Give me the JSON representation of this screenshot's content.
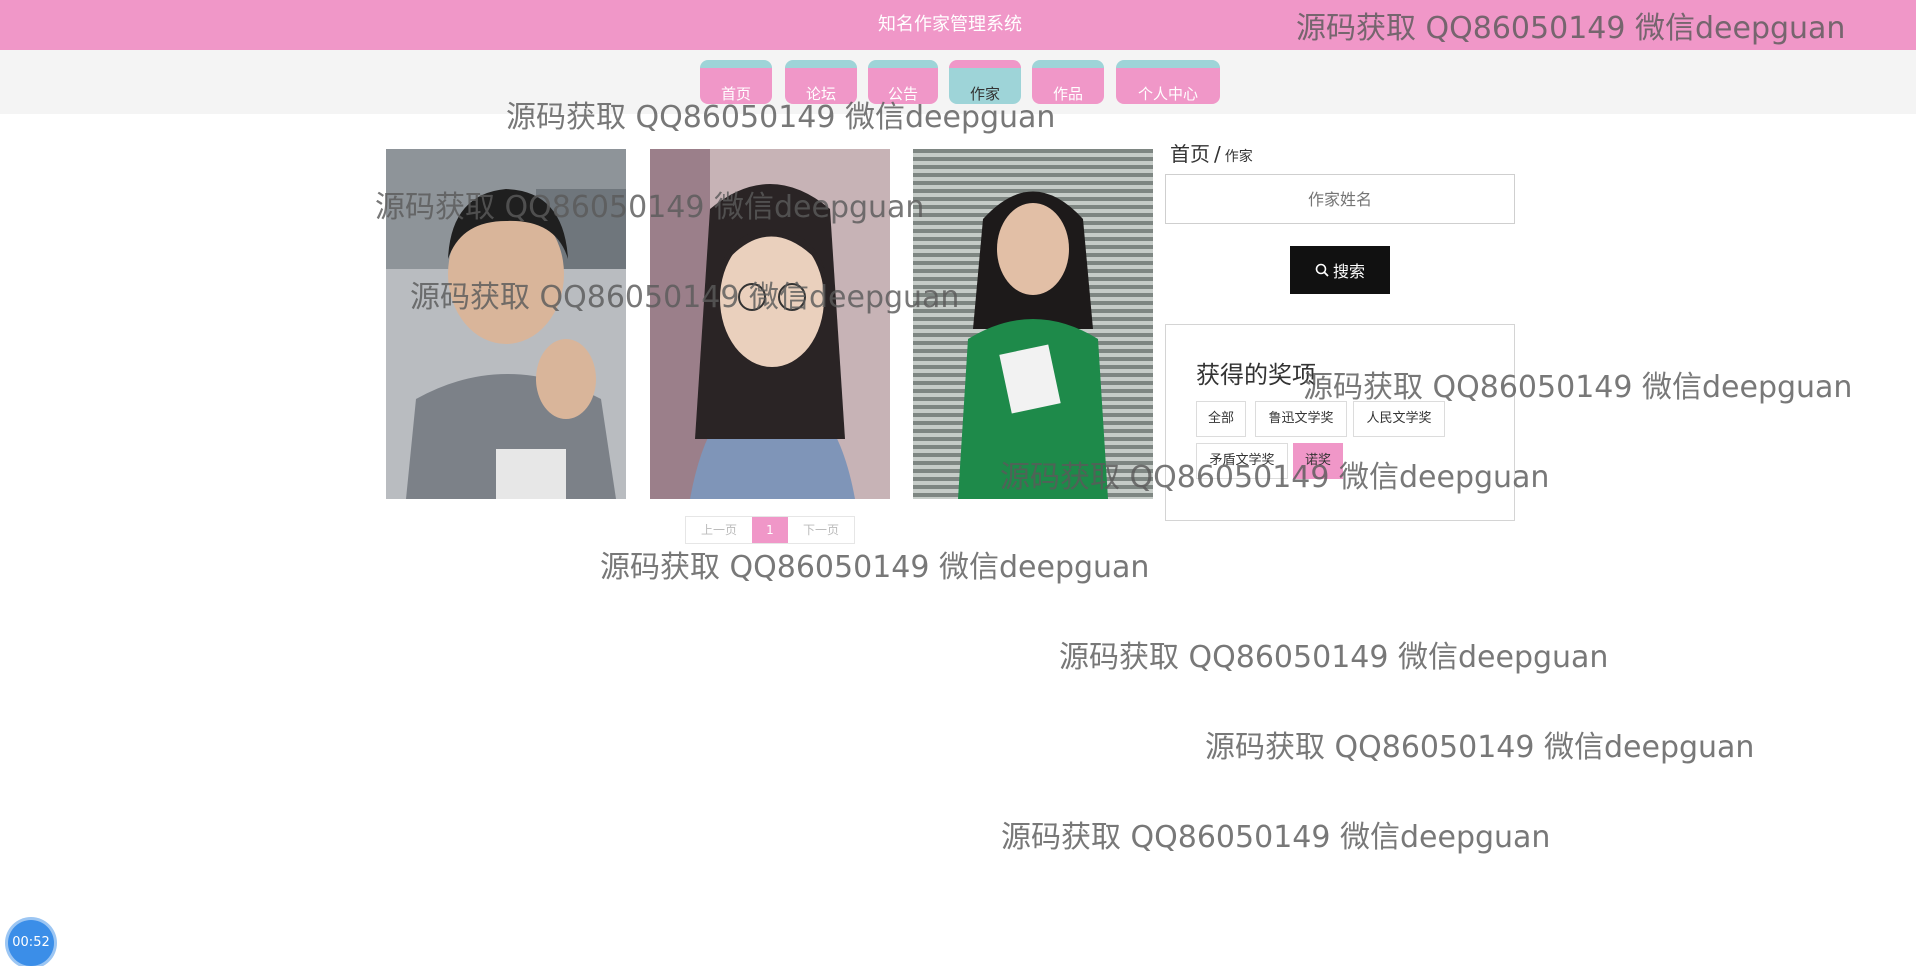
{
  "header": {
    "title": "知名作家管理系统"
  },
  "nav": {
    "items": [
      {
        "label": "首页"
      },
      {
        "label": "论坛"
      },
      {
        "label": "公告"
      },
      {
        "label": "作家"
      },
      {
        "label": "作品"
      },
      {
        "label": "个人中心"
      }
    ],
    "active": "作家"
  },
  "writers": [
    {
      "photo": "writer-photo-man"
    },
    {
      "photo": "writer-photo-woman-glasses"
    },
    {
      "photo": "writer-photo-woman-green"
    }
  ],
  "pagination": {
    "prev": "上一页",
    "current": "1",
    "next": "下一页"
  },
  "breadcrumb": {
    "home": "首页",
    "sep": "/",
    "current": "作家"
  },
  "search": {
    "placeholder": "作家姓名",
    "button": "搜索",
    "icon": "search-icon"
  },
  "awards": {
    "title": "获得的奖项",
    "tags": [
      {
        "label": "全部"
      },
      {
        "label": "鲁迅文学奖"
      },
      {
        "label": "人民文学奖"
      },
      {
        "label": "矛盾文学奖"
      },
      {
        "label": "诺奖"
      }
    ],
    "active": "诺奖"
  },
  "watermark": "源码获取 QQ86050149 微信deepguan",
  "timer": "00:52",
  "colors": {
    "accent_pink": "#f097c8",
    "accent_teal": "#9ed4d8",
    "dark": "#111111"
  }
}
